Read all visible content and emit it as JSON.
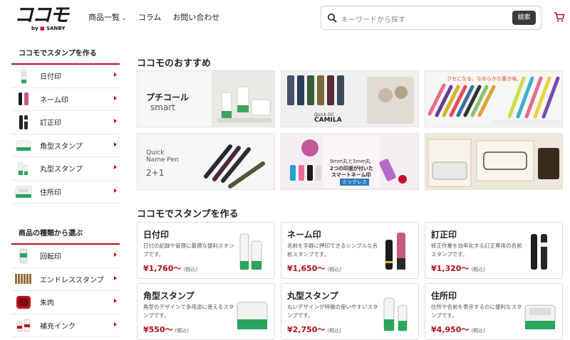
{
  "header": {
    "logo_text": "ココモ",
    "logo_by": "by",
    "logo_brand": "SANBY",
    "nav": [
      {
        "label": "商品一覧"
      },
      {
        "label": "コラム"
      },
      {
        "label": "お問い合わせ"
      }
    ],
    "search_placeholder": "キーワードから探す",
    "search_button": "検索"
  },
  "sidebar": {
    "heading": "ココモでスタンプを作る",
    "items": [
      {
        "label": "日付印"
      },
      {
        "label": "ネーム印"
      },
      {
        "label": "訂正印"
      },
      {
        "label": "角型スタンプ"
      },
      {
        "label": "丸型スタンプ"
      },
      {
        "label": "住所印"
      }
    ]
  },
  "sidebar2": {
    "heading": "商品の種類から選ぶ",
    "items": [
      {
        "label": "回転印"
      },
      {
        "label": "エンドレススタンプ"
      },
      {
        "label": "朱肉"
      },
      {
        "label": "補充インク"
      }
    ]
  },
  "recommend": {
    "title": "ココモのおすすめ",
    "banners": [
      {
        "text1": "プチコール",
        "text2": "smart"
      },
      {
        "text1": "Quick Oil",
        "text2": "CAMILA"
      },
      {
        "text1": "クセになる、なめらかな書き味。",
        "text2": ""
      },
      {
        "text1": "Quick",
        "text2": "Name Pen",
        "text3": "2+1"
      },
      {
        "text1": "9mm丸と5mm丸",
        "text2": "2つの印面が付いた",
        "text3": "スマートネーム印",
        "text4": "ミックレス"
      },
      {
        "text1": "",
        "text2": ""
      }
    ]
  },
  "make": {
    "title": "ココモでスタンプを作る",
    "cards": [
      {
        "title": "日付印",
        "desc": "日付の記録や管理に最適な便利スタンプです。",
        "price": "¥1,760〜",
        "tax": "(税込)"
      },
      {
        "title": "ネーム印",
        "desc": "名前を手軽に押印できるシンプルな名前スタンプです。",
        "price": "¥1,650〜",
        "tax": "(税込)"
      },
      {
        "title": "訂正印",
        "desc": "修正作業を効率化する訂正専用の名前スタンプです。",
        "price": "¥1,320〜",
        "tax": "(税込)"
      },
      {
        "title": "角型スタンプ",
        "desc": "角型のデザインで多用途に使えるスタンプです。",
        "price": "¥550〜",
        "tax": "(税込)"
      },
      {
        "title": "丸型スタンプ",
        "desc": "丸いデザインが特徴の使いやすいスタンプです。",
        "price": "¥2,750〜",
        "tax": "(税込)"
      },
      {
        "title": "住所印",
        "desc": "住所や名前を表示するのに便利なスタンプです。",
        "price": "¥4,950〜",
        "tax": "(税込)"
      }
    ]
  },
  "colors": {
    "accent": "#b0121b",
    "dark": "#3a3a3a"
  }
}
